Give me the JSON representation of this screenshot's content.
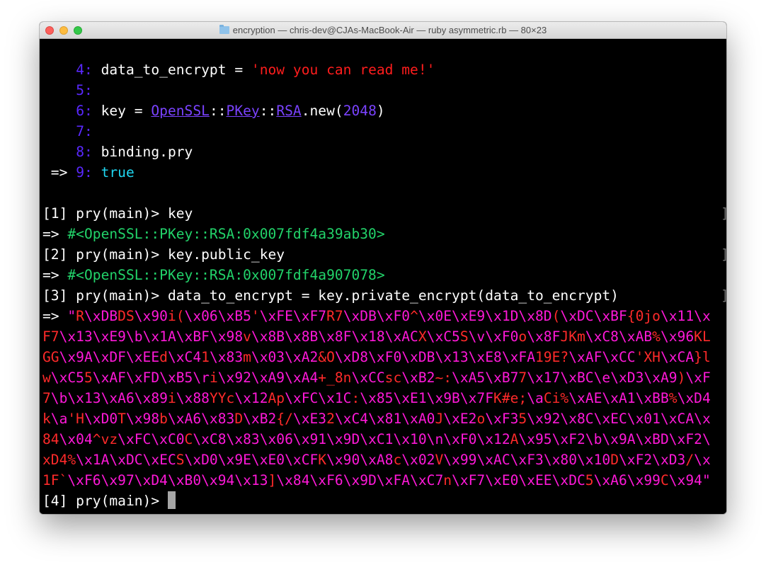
{
  "window": {
    "title": "encryption — chris-dev@CJAs-MacBook-Air — ruby asymmetric.rb — 80×23",
    "folder_icon": "folder-icon"
  },
  "code": [
    {
      "num": "4",
      "parts": [
        "data_to_encrypt = ",
        "'now you can read me!'"
      ]
    },
    {
      "num": "5"
    },
    {
      "num": "6",
      "parts": [
        "key = ",
        "OpenSSL",
        "::",
        "PKey",
        "::",
        "RSA",
        ".new(",
        "2048",
        ")"
      ]
    },
    {
      "num": "7"
    },
    {
      "num": "8",
      "parts": [
        "binding.pry"
      ]
    },
    {
      "arrow": "=>",
      "num": "9",
      "parts": [
        "true"
      ]
    }
  ],
  "session": [
    {
      "prompt": "[1] pry(main)> ",
      "input": "key",
      "arrow": "=> ",
      "result": "#<OpenSSL::PKey::RSA:0x007fdf4a39ab30>"
    },
    {
      "prompt": "[2] pry(main)> ",
      "input": "key.public_key",
      "arrow": "=> ",
      "result": "#<OpenSSL::PKey::RSA:0x007fdf4a907078>"
    },
    {
      "prompt": "[3] pry(main)> ",
      "input": "data_to_encrypt = key.private_encrypt(data_to_encrypt)",
      "arrow": "=> "
    }
  ],
  "output": [
    "\"R\\xDBDS\\x90i(\\x06\\xB5'\\xFE\\xF7R7\\xDB\\xF0^\\x0E\\xE9\\x1D\\x8D(\\xDC\\xBF{0jo\\x11\\x",
    "F7\\x13\\xE9\\b\\x1A\\xBF\\x98v\\x8B\\x8B\\x8F\\x18\\xACX\\xC5S\\v\\xF0o\\x8FJKm\\xC8\\xAB%\\x96KL",
    "GG\\x9A\\xDF\\xEEd\\xC41\\x83m\\x03\\xA2&O\\xD8\\xF0\\xDB\\x13\\xE8\\xFA19E?\\xAF\\xCC'XH\\xCA}l",
    "w\\xC55\\xAF\\xFD\\xB5\\ri\\x92\\xA9\\xA4+_8n\\xCCsc\\xB2~:\\xA5\\xB77\\x17\\xBC\\e\\xD3\\xA9)\\xF",
    "7\\b\\x13\\xA6\\x89i\\x88YYc\\x12Ap\\xFC\\x1C:\\x85\\xE1\\x9B\\x7FK#e;\\aCi%\\xAE\\xA1\\xBB%\\xD4",
    "k\\a'H\\xD0T\\x98b\\xA6\\x83D\\xB2{/\\xE32\\xC4\\x81\\xA0J\\xE2o\\xF35\\x92\\x8C\\xEC\\x01\\xCA\\x",
    "84\\x04^vz\\xFC\\xC0C\\xC8\\x83\\x06\\x91\\x9D\\xC1\\x10\\n\\xF0\\x12A\\x95\\xF2\\b\\x9A\\xBD\\xF2\\",
    "xD4%\\x1A\\xDC\\xECS\\xD0\\x9E\\xE0\\xCFK\\x90\\xA8c\\x02V\\x99\\xAC\\xF3\\x80\\x10D\\xF2\\xD3/\\x",
    "1F`\\xF6\\x97\\xD4\\xB0\\x94\\x13]\\x84\\xF6\\x9D\\xFA\\xC7n\\xF7\\xE0\\xEE\\xDC5\\xA6\\x99C\\x94\""
  ],
  "current_prompt": "[4] pry(main)> ",
  "colors": {
    "line_number": "#5a28ff",
    "string": "#ff1d1d",
    "constant": "#7a42ff",
    "boolean": "#1fd6f0",
    "object": "#22d36a",
    "binary_escape": "#ff18d8",
    "binary_literal": "#ff2a2a"
  }
}
